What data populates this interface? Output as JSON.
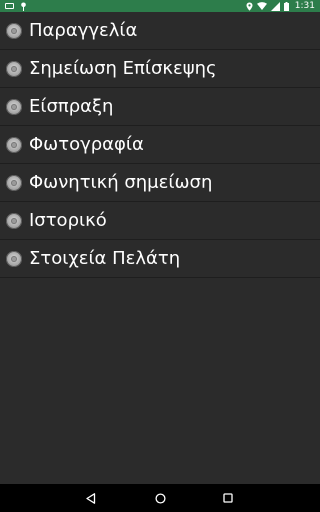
{
  "status_bar": {
    "background_color": "#2d7d4b",
    "left_icons": [
      "screenshot-icon",
      "pin-icon"
    ],
    "right_icons": [
      "location-icon",
      "wifi-icon",
      "signal-icon",
      "battery-icon"
    ],
    "time": "1:31"
  },
  "menu": {
    "bullet_icon": "radio-bullet-icon",
    "items": [
      {
        "label": "Παραγγελία"
      },
      {
        "label": "Σημείωση Επίσκεψης"
      },
      {
        "label": "Είσπραξη"
      },
      {
        "label": "Φωτογραφία"
      },
      {
        "label": "Φωνητική σημείωση"
      },
      {
        "label": "Ιστορικό"
      },
      {
        "label": "Στοιχεία Πελάτη"
      }
    ]
  },
  "nav_bar": {
    "buttons": [
      "back-icon",
      "home-icon",
      "recent-apps-icon"
    ]
  }
}
